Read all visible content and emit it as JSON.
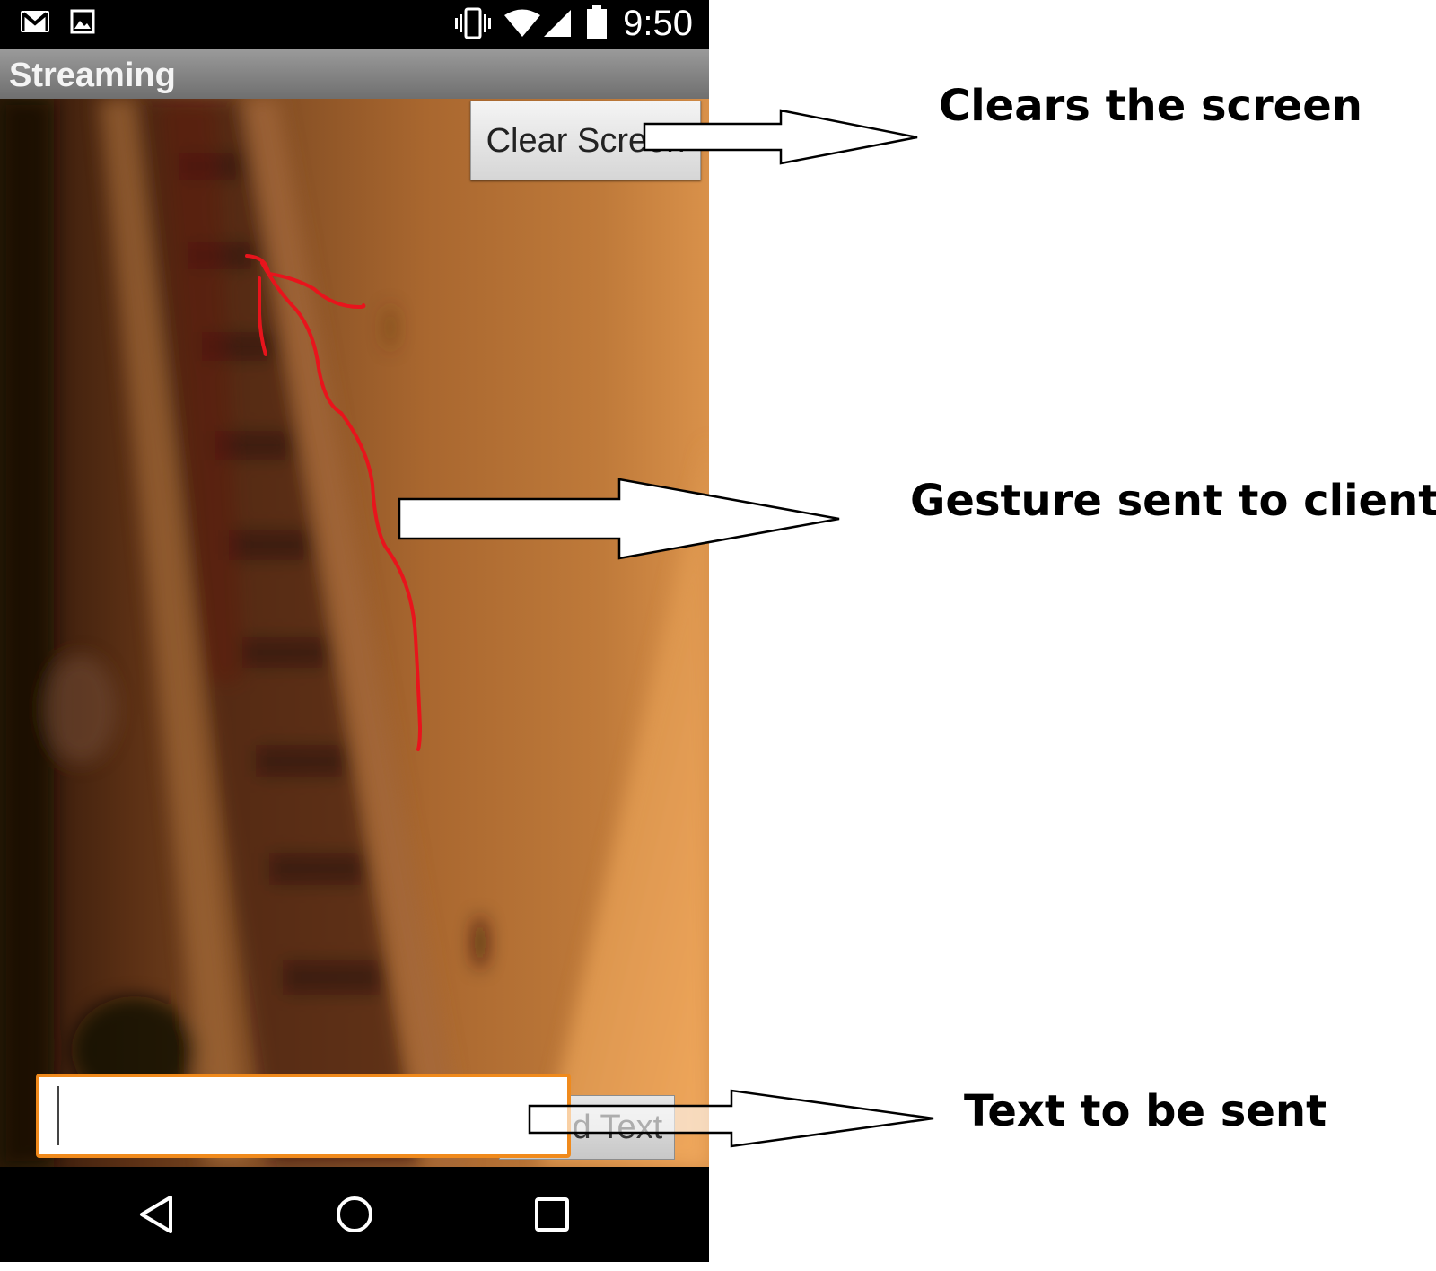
{
  "status_bar": {
    "time": "9:50",
    "icons": [
      "gmail-icon",
      "gallery-icon",
      "vibrate-icon",
      "wifi-icon",
      "signal-icon",
      "battery-icon"
    ]
  },
  "action_bar": {
    "title": "Streaming"
  },
  "camera_view": {
    "clear_button_label": "Clear Screen",
    "gesture_stroke_color": "#e8141c"
  },
  "composer": {
    "input_value": "",
    "send_button_label": "Send Text",
    "focus_color": "#f08a1c"
  },
  "nav_bar": {
    "icons": [
      "back-icon",
      "home-icon",
      "recents-icon"
    ]
  },
  "annotations": {
    "clear": "Clears the screen",
    "gesture": "Gesture sent to client",
    "text": "Text to be sent"
  }
}
